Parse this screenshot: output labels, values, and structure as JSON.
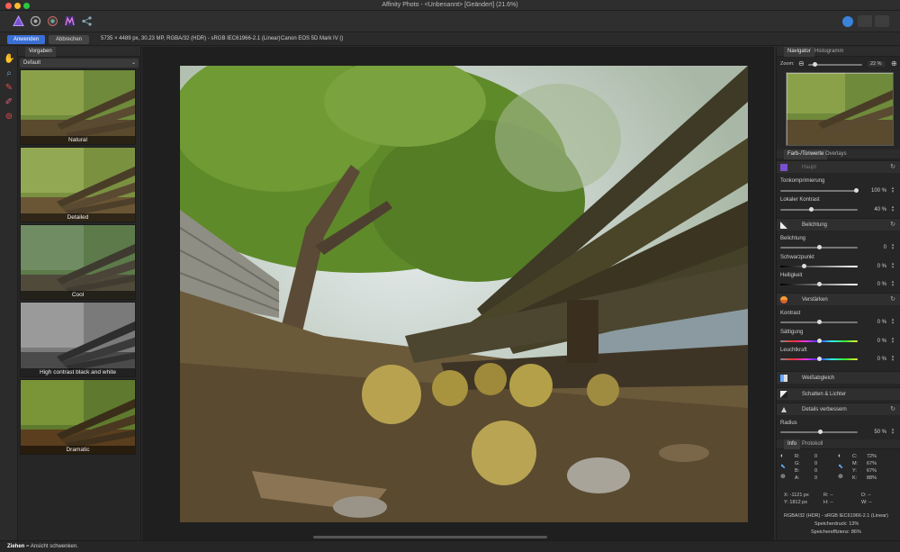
{
  "window": {
    "title": "Affinity Photo - <Unbenannt> [Geändert] (21.6%)"
  },
  "toolbar": {
    "personas": [
      "photo-persona-icon",
      "liquify-persona-icon",
      "develop-persona-icon",
      "tone-mapping-persona-icon",
      "export-persona-icon"
    ]
  },
  "context": {
    "apply_label": "Anwenden",
    "cancel_label": "Abbrechen",
    "image_info": "5735 × 4489 px, 30.23 MP, RGBA/32 (HDR) - sRGB IEC61966-2.1 (Linear)",
    "camera": "Canon EOS 5D Mark IV ()"
  },
  "presets": {
    "tab_label": "Vorgaben",
    "dropdown_value": "Default",
    "items": [
      {
        "label": "Natural"
      },
      {
        "label": "Detailed"
      },
      {
        "label": "Cool"
      },
      {
        "label": "High contrast black and white"
      },
      {
        "label": "Dramatic"
      }
    ]
  },
  "navigator": {
    "tab_navigator": "Navigator",
    "tab_histogram": "Histogramm",
    "zoom_label": "Zoom:",
    "zoom_value": "22 %"
  },
  "adjustments": {
    "tab_tone": "Farb-/Tonwerte",
    "tab_overlays": "Overlays",
    "tone_section": "Haupt",
    "tone_compression_label": "Tonkomprimierung",
    "tone_compression_value": "100 %",
    "local_contrast_label": "Lokaler Kontrast",
    "local_contrast_value": "40 %",
    "exposure_section": "Belichtung",
    "exposure_label": "Belichtung",
    "exposure_value": "0",
    "black_point_label": "Schwarzpunkt",
    "black_point_value": "0 %",
    "brightness_label": "Helligkeit",
    "brightness_value": "0 %",
    "enhance_section": "Verstärken",
    "contrast_label": "Kontrast",
    "contrast_value": "0 %",
    "saturation_label": "Sättigung",
    "saturation_value": "0 %",
    "vibrance_label": "Leuchtkraft",
    "vibrance_value": "0 %",
    "white_balance_section": "Weißabgleich",
    "shadows_highlights_section": "Schatten & Lichter",
    "detail_section": "Details verbessern",
    "radius_label": "Radius",
    "radius_value": "50 %"
  },
  "info": {
    "tab_info": "Info",
    "tab_protocol": "Protokoll",
    "rgb": {
      "r": "0",
      "g": "0",
      "b": "0",
      "a": "0"
    },
    "cmyk": {
      "c": "72%",
      "m": "67%",
      "y": "67%",
      "k": "88%"
    },
    "coords_x": "X: -1121 px",
    "coords_y": "Y: 1812 px",
    "r_dash": "R: --",
    "h_dash": "H: --",
    "d_dash": "D: --",
    "w_dash": "W: --",
    "color_profile": "RGBA/32 (HDR) - sRGB IEC61966-2.1 (Linear)",
    "memory_pressure": "Speicherdruck: 13%",
    "memory_efficiency": "Speichereffizienz: 86%"
  },
  "status": {
    "bold": "Ziehen",
    "text": " = Ansicht schwenken."
  }
}
